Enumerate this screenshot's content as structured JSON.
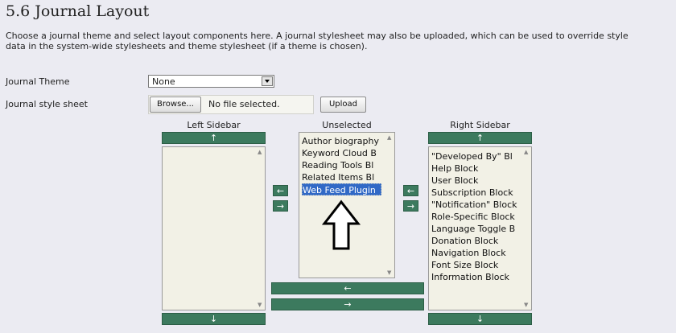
{
  "page": {
    "heading": "5.6 Journal Layout",
    "description_line1": "Choose a journal theme and select layout components here. A journal stylesheet may also be uploaded, which can be used to override style",
    "description_line2": "data in the system-wide stylesheets and theme stylesheet (if a theme is chosen)."
  },
  "form": {
    "theme_label": "Journal Theme",
    "theme_value": "None",
    "stylesheet_label": "Journal style sheet",
    "browse_label": "Browse...",
    "file_status": "No file selected.",
    "upload_label": "Upload"
  },
  "columns": {
    "left": {
      "title": "Left Sidebar",
      "up": "↑",
      "down": "↓",
      "items": []
    },
    "unselected": {
      "title": "Unselected",
      "items": [
        "Author biography",
        "Keyword Cloud B",
        "Reading Tools Bl",
        "Related Items Bl",
        "Web Feed Plugin"
      ],
      "selected_item": "Web Feed Plugin"
    },
    "right": {
      "title": "Right Sidebar",
      "up": "↑",
      "down": "↓",
      "items": [
        "\"Developed By\" Bl",
        "Help Block",
        "User Block",
        "Subscription Block",
        "\"Notification\" Block",
        "Role-Specific Block",
        "Language Toggle B",
        "Donation Block",
        "Navigation Block",
        "Font Size Block",
        "Information Block"
      ]
    }
  },
  "arrows": {
    "to_left": "←",
    "to_right": "→",
    "bottom_left": "←",
    "bottom_right": "→"
  },
  "colors": {
    "accent_green": "#3c7a5e",
    "selection_blue": "#3169c6",
    "list_bg": "#f2f1e6"
  },
  "annotation": {
    "icon": "up-arrow-outline"
  }
}
